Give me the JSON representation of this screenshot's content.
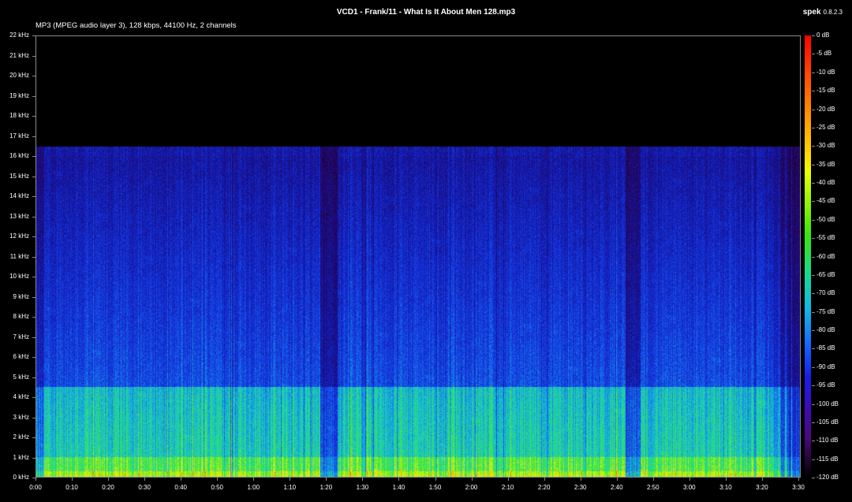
{
  "window": {
    "title": "VCD1 - Frank/11 - What Is It About Men 128.mp3",
    "app_name": "spek",
    "app_version": "0.8.2.3",
    "file_info": "MP3 (MPEG audio layer 3), 128 kbps, 44100 Hz, 2 channels"
  },
  "axes": {
    "frequency_labels": [
      "0 kHz",
      "1 kHz",
      "2 kHz",
      "3 kHz",
      "4 kHz",
      "5 kHz",
      "6 kHz",
      "7 kHz",
      "8 kHz",
      "9 kHz",
      "10 kHz",
      "11 kHz",
      "12 kHz",
      "13 kHz",
      "14 kHz",
      "15 kHz",
      "16 kHz",
      "17 kHz",
      "18 kHz",
      "19 kHz",
      "20 kHz",
      "21 kHz",
      "22 kHz"
    ],
    "time_labels": [
      "0:00",
      "0:10",
      "0:20",
      "0:30",
      "0:40",
      "0:50",
      "1:00",
      "1:10",
      "1:20",
      "1:30",
      "1:40",
      "1:50",
      "2:00",
      "2:10",
      "2:20",
      "2:30",
      "2:40",
      "2:50",
      "3:00",
      "3:10",
      "3:20",
      "3:30"
    ],
    "db_labels": [
      "0 dB",
      "-5 dB",
      "-10 dB",
      "-15 dB",
      "-20 dB",
      "-25 dB",
      "-30 dB",
      "-35 dB",
      "-40 dB",
      "-45 dB",
      "-50 dB",
      "-55 dB",
      "-60 dB",
      "-65 dB",
      "-70 dB",
      "-75 dB",
      "-80 dB",
      "-85 dB",
      "-90 dB",
      "-95 dB",
      "-100 dB",
      "-105 dB",
      "-110 dB",
      "-115 dB",
      "-120 dB"
    ]
  },
  "spectrogram": {
    "duration_seconds": 210,
    "max_frequency_khz": 22,
    "cutoff_khz": 16.5,
    "quiet_gaps_seconds": [
      [
        78,
        83
      ],
      [
        162,
        166
      ]
    ],
    "palette": [
      "#000000",
      "#4a0a7a",
      "#1620e8",
      "#12b7e6",
      "#39e60a",
      "#ffd800",
      "#ff0000"
    ]
  }
}
